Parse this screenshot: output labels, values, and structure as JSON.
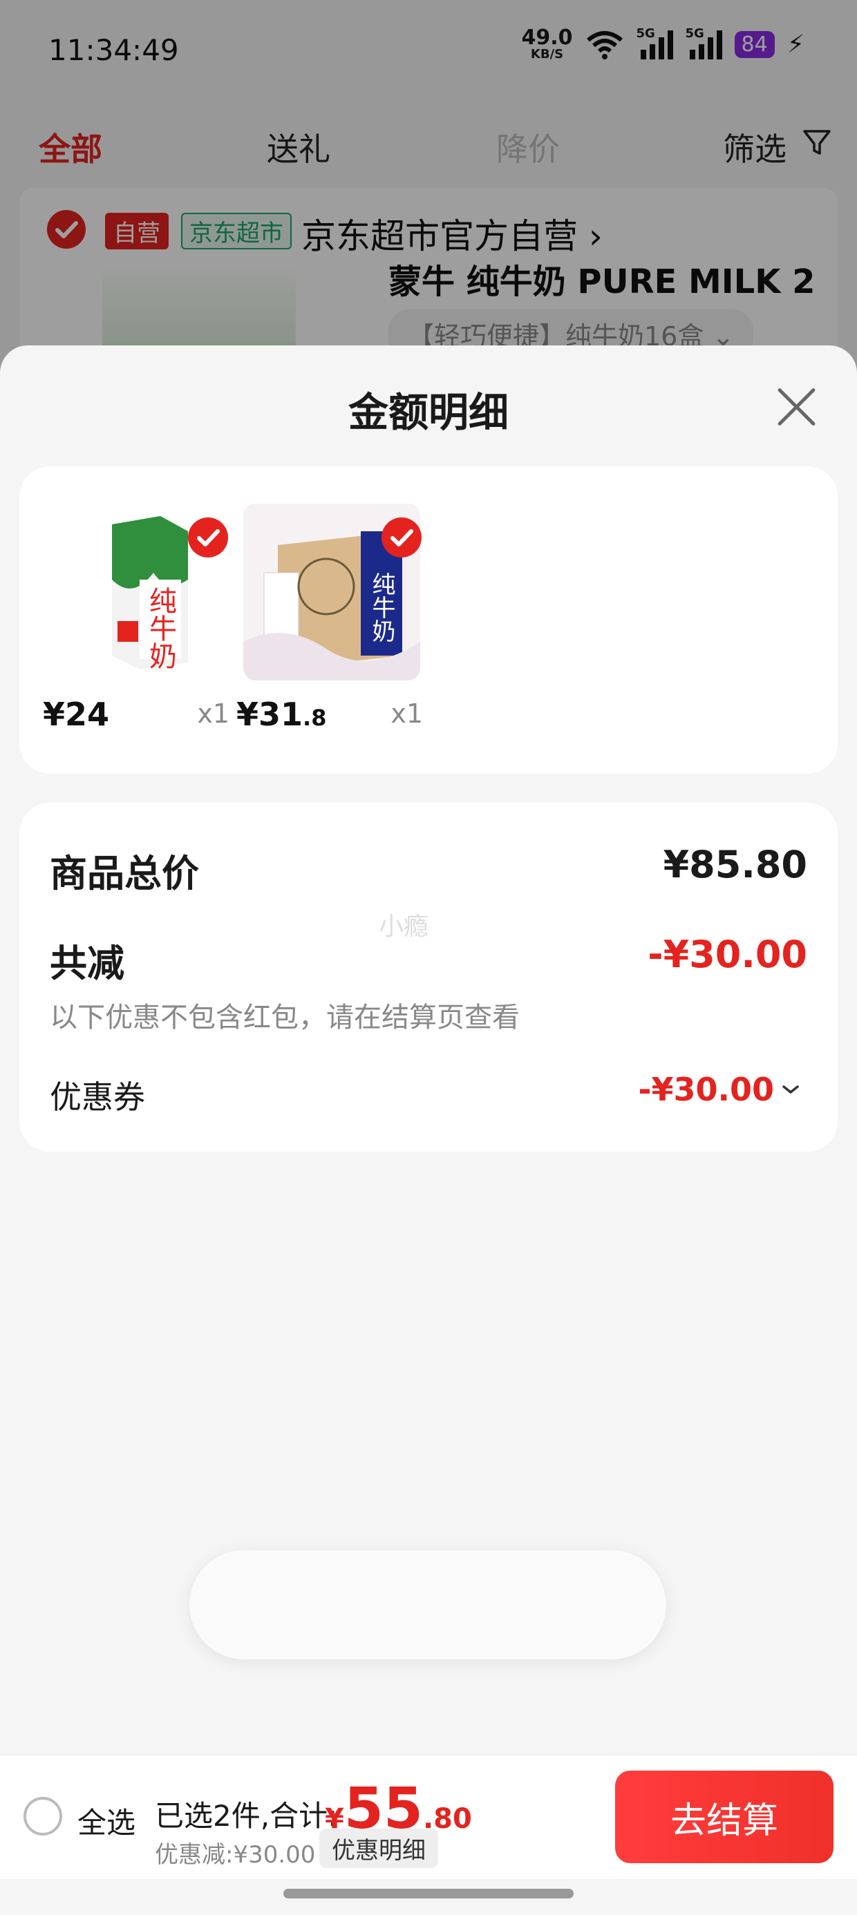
{
  "status": {
    "time": "11:34:49",
    "net_speed": "49.0",
    "net_unit": "KB/S",
    "sig1": "5G",
    "sig2": "5G",
    "battery": "84"
  },
  "tabs": [
    {
      "label": "全部",
      "active": true
    },
    {
      "label": "送礼"
    },
    {
      "label": "降价"
    },
    {
      "label": "筛选"
    }
  ],
  "shop": {
    "badge_self": "自营",
    "badge_market": "京东超市",
    "name": "京东超市官方自营",
    "chevron": "›",
    "product_title": "蒙牛 纯牛奶 PURE MILK 2",
    "product_spec": "【轻巧便捷】纯牛奶16盒 ⌄"
  },
  "modal": {
    "title": "金额明细",
    "items": [
      {
        "price_int": "¥24",
        "price_dec": "",
        "qty": "x1",
        "img_text": "纯牛奶"
      },
      {
        "price_int": "¥31",
        "price_dec": ".8",
        "qty": "x1",
        "img_text": "纯牛奶"
      }
    ],
    "summary": {
      "total_label": "商品总价",
      "total_value": "¥85.80",
      "reduce_label": "共减",
      "reduce_value": "-¥30.00",
      "note": "以下优惠不包含红包，请在结算页查看",
      "coupon_label": "优惠券",
      "coupon_value": "-¥30.00",
      "watermark": "小瘾"
    }
  },
  "bottom_bar": {
    "select_all": "全选",
    "selected": "已选2件,合计:",
    "total_currency": "¥",
    "total_int": "55",
    "total_dec": ".80",
    "discount": "优惠减:¥30.00",
    "detail_button": "优惠明细",
    "checkout_button": "去结算"
  },
  "colors": {
    "accent": "#e4231f",
    "self_badge_bg": "#e4231f",
    "market_badge": "#19a56b",
    "battery": "#8a2be2"
  }
}
